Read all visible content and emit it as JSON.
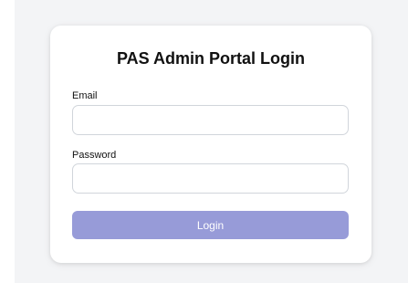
{
  "login": {
    "title": "PAS Admin Portal Login",
    "email_label": "Email",
    "email_value": "",
    "password_label": "Password",
    "password_value": "",
    "submit_label": "Login"
  },
  "colors": {
    "page_background": "#f3f4f6",
    "card_background": "#ffffff",
    "button_background": "#979bd8",
    "button_text": "#ffffff",
    "input_border": "#d1d5db"
  }
}
